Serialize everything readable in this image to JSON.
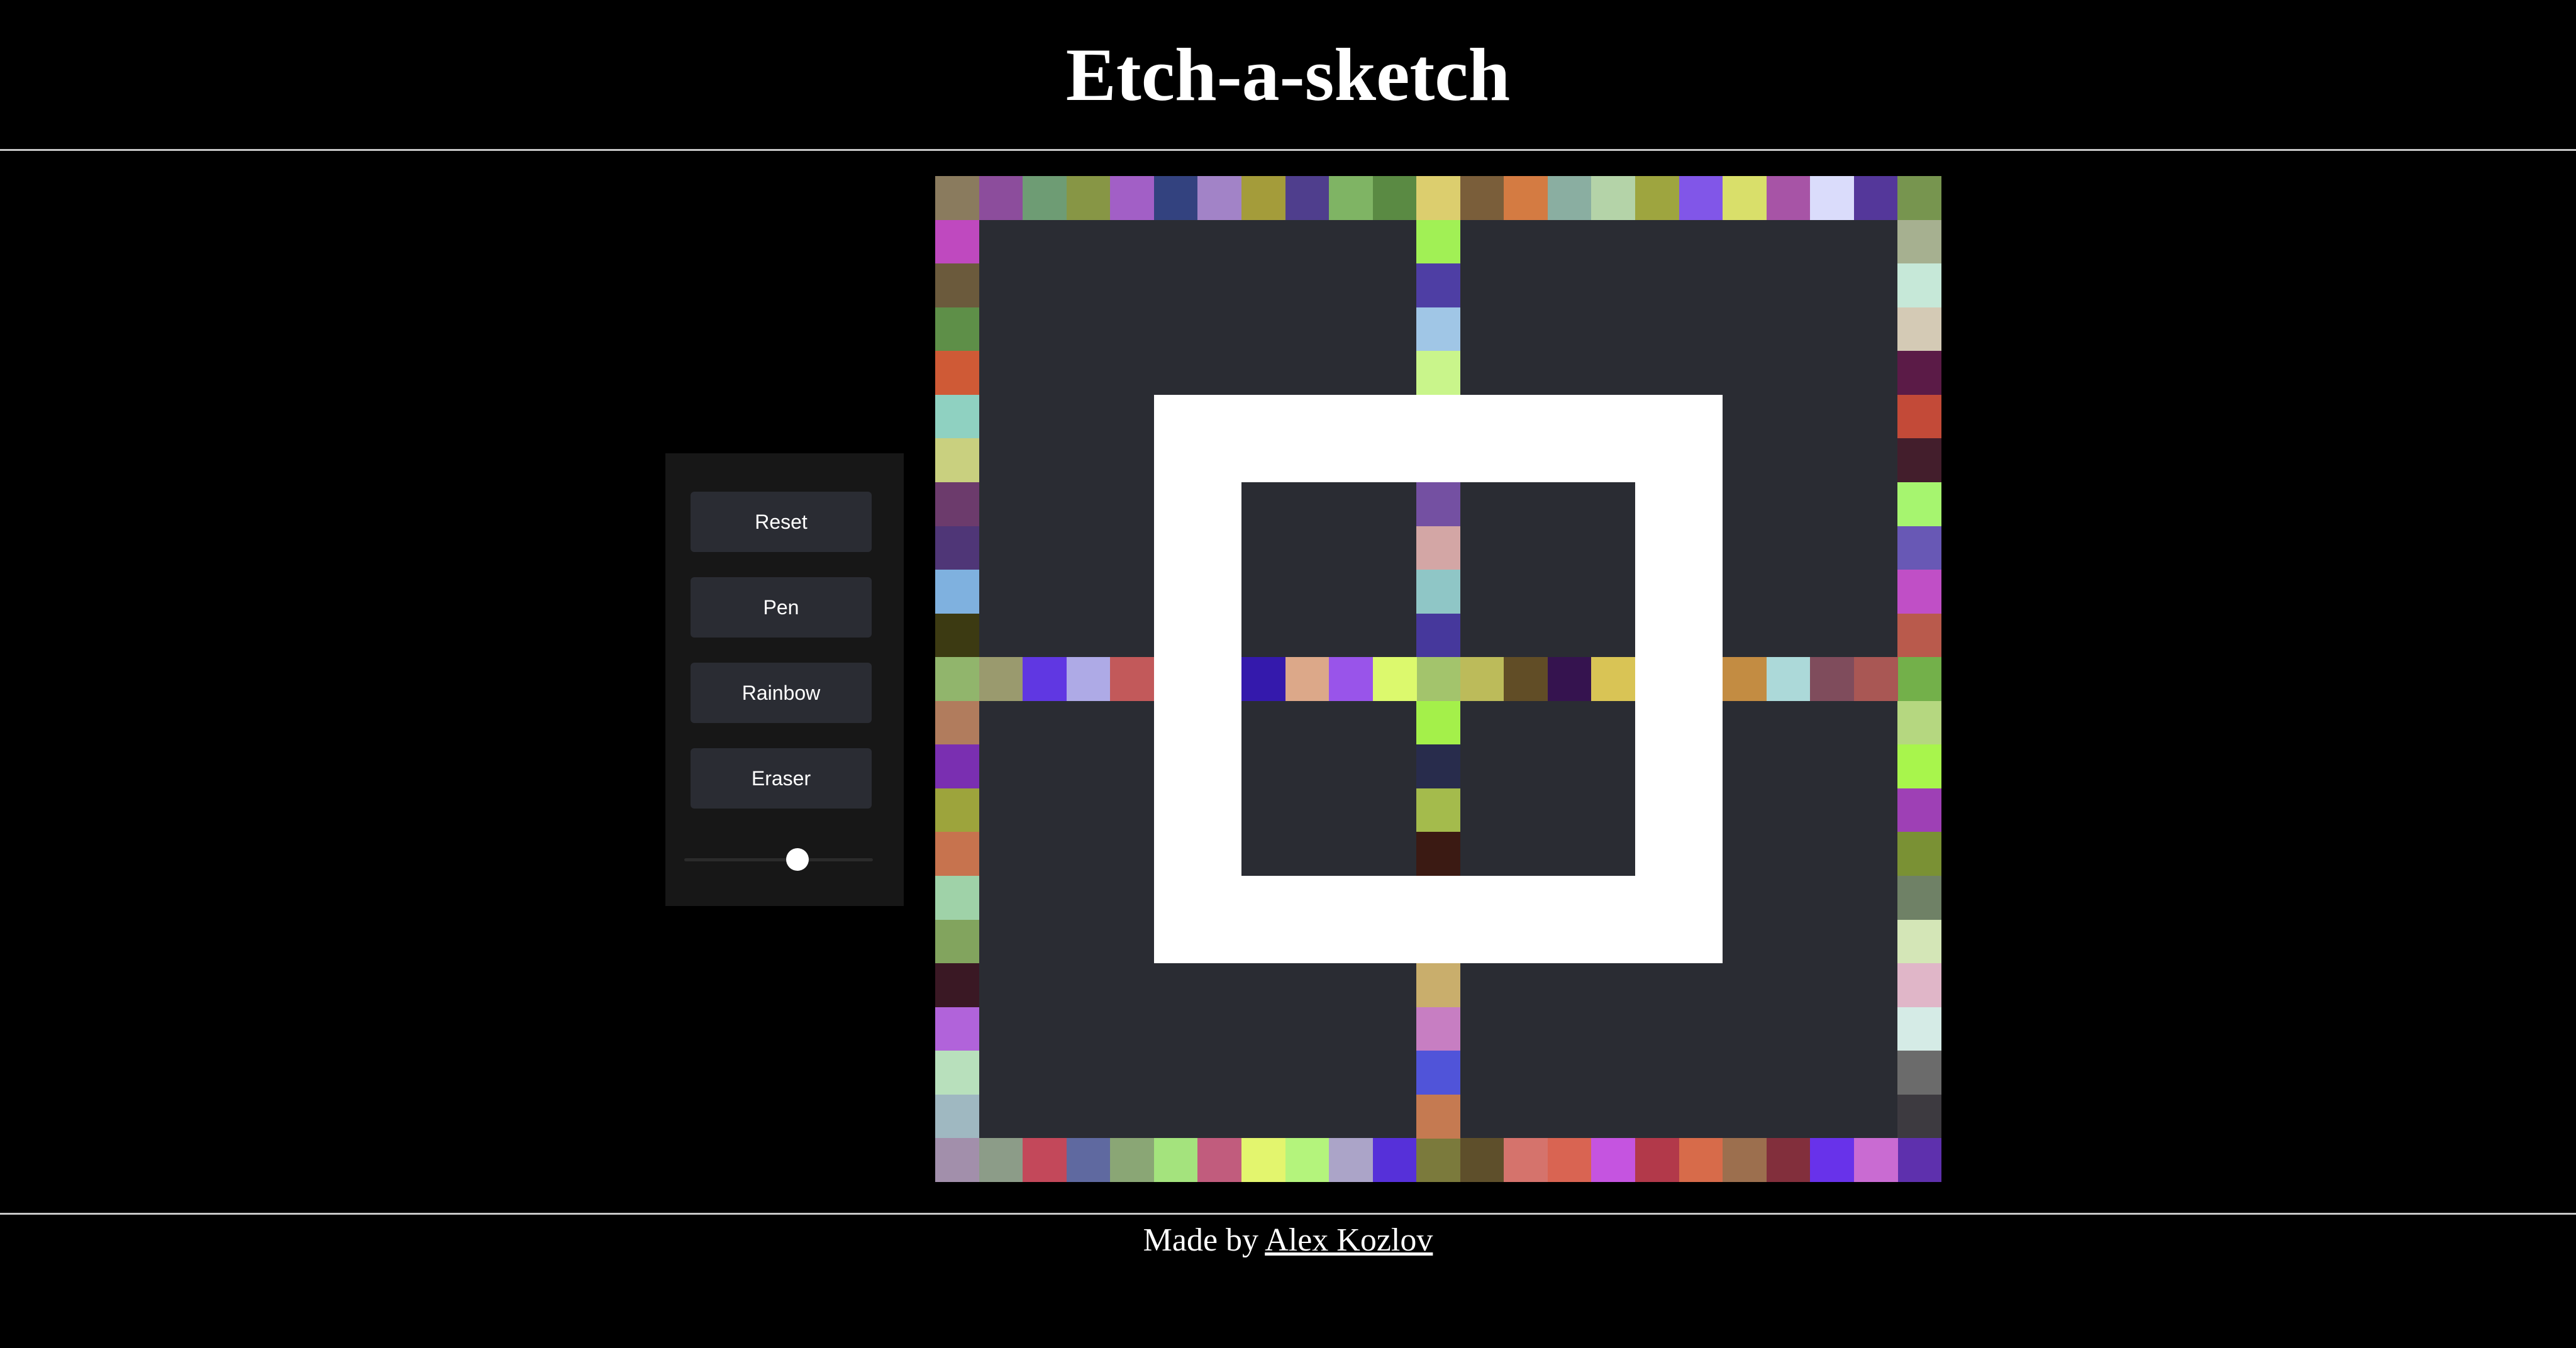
{
  "header": {
    "title": "Etch-a-sketch"
  },
  "controls": {
    "reset_label": "Reset",
    "pen_label": "Pen",
    "rainbow_label": "Rainbow",
    "eraser_label": "Eraser",
    "grid_size_level": 0.6
  },
  "footer": {
    "prefix": "Made by",
    "author": "Alex Kozlov"
  },
  "grid": {
    "size": 23,
    "background": "#2a2c33",
    "painted": [
      [
        0,
        0,
        "#8a7b5e"
      ],
      [
        0,
        1,
        "#8c4d9c"
      ],
      [
        0,
        2,
        "#6e9c74"
      ],
      [
        0,
        3,
        "#879645"
      ],
      [
        0,
        4,
        "#a25fc6"
      ],
      [
        0,
        5,
        "#33427f"
      ],
      [
        0,
        6,
        "#a283c7"
      ],
      [
        0,
        7,
        "#a49c3a"
      ],
      [
        0,
        8,
        "#4f3e8d"
      ],
      [
        0,
        9,
        "#7fb464"
      ],
      [
        0,
        10,
        "#5a8a43"
      ],
      [
        0,
        11,
        "#dcce6e"
      ],
      [
        0,
        12,
        "#7a5e3a"
      ],
      [
        0,
        13,
        "#d47b42"
      ],
      [
        0,
        14,
        "#8aaea1"
      ],
      [
        0,
        15,
        "#b4d3a8"
      ],
      [
        0,
        16,
        "#9ea53f"
      ],
      [
        0,
        17,
        "#8156e8"
      ],
      [
        0,
        18,
        "#d9df6a"
      ],
      [
        0,
        19,
        "#a754a6"
      ],
      [
        0,
        20,
        "#dadcfb"
      ],
      [
        0,
        21,
        "#54379a"
      ],
      [
        0,
        22,
        "#77954f"
      ],
      [
        1,
        0,
        "#bf49bf"
      ],
      [
        2,
        0,
        "#6b5a3c"
      ],
      [
        3,
        0,
        "#5e8f48"
      ],
      [
        4,
        0,
        "#cf5a36"
      ],
      [
        5,
        0,
        "#8fd1c1"
      ],
      [
        6,
        0,
        "#c9d07f"
      ],
      [
        7,
        0,
        "#6c3b6c"
      ],
      [
        8,
        0,
        "#4f3677"
      ],
      [
        9,
        0,
        "#7fb1df"
      ],
      [
        10,
        0,
        "#3c3a12"
      ],
      [
        11,
        0,
        "#91b56c"
      ],
      [
        12,
        0,
        "#b17c5d"
      ],
      [
        13,
        0,
        "#7a2fb1"
      ],
      [
        14,
        0,
        "#9da43c"
      ],
      [
        15,
        0,
        "#c7734e"
      ],
      [
        16,
        0,
        "#9fd2a8"
      ],
      [
        17,
        0,
        "#82a45e"
      ],
      [
        18,
        0,
        "#3a1824"
      ],
      [
        19,
        0,
        "#b163da"
      ],
      [
        20,
        0,
        "#b8e0bc"
      ],
      [
        21,
        0,
        "#9fb8c1"
      ],
      [
        22,
        0,
        "#a28fab"
      ],
      [
        1,
        22,
        "#a6b090"
      ],
      [
        2,
        22,
        "#c6e8d8"
      ],
      [
        3,
        22,
        "#d4cab5"
      ],
      [
        4,
        22,
        "#5b1b47"
      ],
      [
        5,
        22,
        "#c34a38"
      ],
      [
        6,
        22,
        "#431e2c"
      ],
      [
        7,
        22,
        "#a6f56f"
      ],
      [
        8,
        22,
        "#6858b5"
      ],
      [
        9,
        22,
        "#c04fc6"
      ],
      [
        10,
        22,
        "#b95a4c"
      ],
      [
        11,
        22,
        "#73b04a"
      ],
      [
        12,
        22,
        "#b5d780"
      ],
      [
        13,
        22,
        "#a8f54c"
      ],
      [
        14,
        22,
        "#9e40b5"
      ],
      [
        15,
        22,
        "#7a9134"
      ],
      [
        16,
        22,
        "#6f8166"
      ],
      [
        17,
        22,
        "#d4e6b7"
      ],
      [
        18,
        22,
        "#e0b6c8"
      ],
      [
        19,
        22,
        "#d5ebe6"
      ],
      [
        20,
        22,
        "#6b6b6b"
      ],
      [
        21,
        22,
        "#3d3a40"
      ],
      [
        22,
        22,
        "#5e30ad"
      ],
      [
        22,
        1,
        "#8c9c88"
      ],
      [
        22,
        2,
        "#c3485a"
      ],
      [
        22,
        3,
        "#5f69a0"
      ],
      [
        22,
        4,
        "#8aa675"
      ],
      [
        22,
        5,
        "#a4e37d"
      ],
      [
        22,
        6,
        "#c15c7d"
      ],
      [
        22,
        7,
        "#e3f56e"
      ],
      [
        22,
        8,
        "#b4f47c"
      ],
      [
        22,
        9,
        "#aba4c8"
      ],
      [
        22,
        10,
        "#5630d9"
      ],
      [
        22,
        11,
        "#7b7a3c"
      ],
      [
        22,
        12,
        "#5e4f2b"
      ],
      [
        22,
        13,
        "#d5736c"
      ],
      [
        22,
        14,
        "#d96452"
      ],
      [
        22,
        15,
        "#c554e0"
      ],
      [
        22,
        16,
        "#b2394a"
      ],
      [
        22,
        17,
        "#d76b4a"
      ],
      [
        22,
        18,
        "#9c6f4e"
      ],
      [
        22,
        19,
        "#822f3c"
      ],
      [
        22,
        20,
        "#6832ea"
      ],
      [
        22,
        21,
        "#c96bd2"
      ],
      [
        1,
        11,
        "#a1f055"
      ],
      [
        2,
        11,
        "#4e3ea4"
      ],
      [
        3,
        11,
        "#a0c6e6"
      ],
      [
        4,
        11,
        "#c9f58b"
      ],
      [
        7,
        11,
        "#7450a2"
      ],
      [
        8,
        11,
        "#d3a6a5"
      ],
      [
        9,
        11,
        "#8fc6c6"
      ],
      [
        10,
        11,
        "#46389c"
      ],
      [
        11,
        11,
        "#a3c46c"
      ],
      [
        12,
        11,
        "#a4f04a"
      ],
      [
        13,
        11,
        "#282c4c"
      ],
      [
        14,
        11,
        "#a4bb4c"
      ],
      [
        15,
        11,
        "#3b1a13"
      ],
      [
        18,
        11,
        "#c9ae6c"
      ],
      [
        19,
        11,
        "#c77ec2"
      ],
      [
        20,
        11,
        "#5054d9"
      ],
      [
        21,
        11,
        "#c57a51"
      ],
      [
        11,
        1,
        "#9a9a6e"
      ],
      [
        11,
        2,
        "#6037e2"
      ],
      [
        11,
        3,
        "#aeaae6"
      ],
      [
        11,
        4,
        "#c2595a"
      ],
      [
        11,
        7,
        "#3419ac"
      ],
      [
        11,
        8,
        "#dca889"
      ],
      [
        11,
        9,
        "#9954ea"
      ],
      [
        11,
        10,
        "#dcf96d"
      ],
      [
        11,
        12,
        "#bcbb5a"
      ],
      [
        11,
        13,
        "#614d26"
      ],
      [
        11,
        14,
        "#35134f"
      ],
      [
        11,
        15,
        "#d9c455"
      ],
      [
        11,
        18,
        "#c38c42"
      ],
      [
        11,
        19,
        "#acd9d9"
      ],
      [
        11,
        20,
        "#7f4c5c"
      ],
      [
        11,
        21,
        "#a95754"
      ]
    ],
    "white_square": {
      "outer": [
        5,
        5,
        18,
        18
      ],
      "inner": [
        7,
        7,
        16,
        16
      ]
    }
  }
}
